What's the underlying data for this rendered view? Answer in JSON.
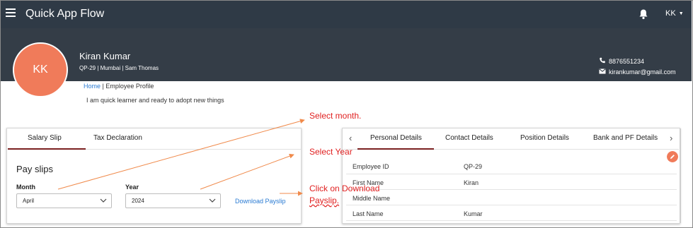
{
  "app": {
    "title": "Quick App Flow",
    "user_initials": "KK"
  },
  "profile": {
    "avatar_initials": "KK",
    "name": "Kiran Kumar",
    "meta": "QP-29 | Mumbai | Sam Thomas",
    "phone": "8876551234",
    "email": "kirankumar@gmail.com",
    "breadcrumb_home": "Home",
    "breadcrumb_current": " | Employee Profile",
    "bio": "I am quick learner and ready to adopt new things"
  },
  "left_panel": {
    "tabs": [
      {
        "label": "Salary Slip",
        "active": true
      },
      {
        "label": "Tax Declaration",
        "active": false
      }
    ],
    "section_title": "Pay slips",
    "month_label": "Month",
    "month_value": "April",
    "year_label": "Year",
    "year_value": "2024",
    "download_label": "Download Payslip"
  },
  "right_panel": {
    "tabs": [
      {
        "label": "Personal Details",
        "active": true
      },
      {
        "label": "Contact Details",
        "active": false
      },
      {
        "label": "Position Details",
        "active": false
      },
      {
        "label": "Bank and PF Details",
        "active": false
      }
    ],
    "rows": [
      {
        "label": "Employee ID",
        "value": "QP-29"
      },
      {
        "label": "First Name",
        "value": "Kiran"
      },
      {
        "label": "Middle Name",
        "value": ""
      },
      {
        "label": "Last Name",
        "value": "Kumar"
      }
    ]
  },
  "annotations": {
    "select_month": "Select month.",
    "select_year": "Select Year",
    "click_download_line1": "Click on Download",
    "click_download_line2": "Payslip."
  },
  "colors": {
    "topbar": "#2f3a46",
    "profile_band": "#343d47",
    "accent_avatar": "#f07b5a",
    "link": "#2a7bd3",
    "annotation": "#e02020",
    "arrow": "#f08a4b",
    "tab_underline": "#7a2020"
  },
  "icons": [
    "hamburger-icon",
    "bell-icon",
    "chevron-down-icon",
    "phone-icon",
    "email-icon",
    "edit-icon",
    "chevron-left-icon",
    "chevron-right-icon"
  ]
}
